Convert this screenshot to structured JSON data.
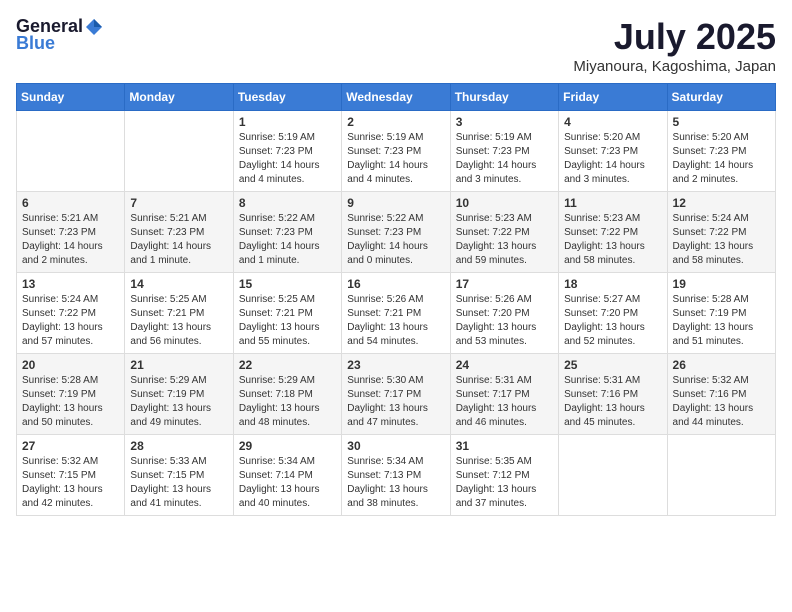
{
  "logo": {
    "general": "General",
    "blue": "Blue"
  },
  "title": "July 2025",
  "subtitle": "Miyanoura, Kagoshima, Japan",
  "headers": [
    "Sunday",
    "Monday",
    "Tuesday",
    "Wednesday",
    "Thursday",
    "Friday",
    "Saturday"
  ],
  "weeks": [
    [
      {
        "day": "",
        "info": ""
      },
      {
        "day": "",
        "info": ""
      },
      {
        "day": "1",
        "info": "Sunrise: 5:19 AM\nSunset: 7:23 PM\nDaylight: 14 hours and 4 minutes."
      },
      {
        "day": "2",
        "info": "Sunrise: 5:19 AM\nSunset: 7:23 PM\nDaylight: 14 hours and 4 minutes."
      },
      {
        "day": "3",
        "info": "Sunrise: 5:19 AM\nSunset: 7:23 PM\nDaylight: 14 hours and 3 minutes."
      },
      {
        "day": "4",
        "info": "Sunrise: 5:20 AM\nSunset: 7:23 PM\nDaylight: 14 hours and 3 minutes."
      },
      {
        "day": "5",
        "info": "Sunrise: 5:20 AM\nSunset: 7:23 PM\nDaylight: 14 hours and 2 minutes."
      }
    ],
    [
      {
        "day": "6",
        "info": "Sunrise: 5:21 AM\nSunset: 7:23 PM\nDaylight: 14 hours and 2 minutes."
      },
      {
        "day": "7",
        "info": "Sunrise: 5:21 AM\nSunset: 7:23 PM\nDaylight: 14 hours and 1 minute."
      },
      {
        "day": "8",
        "info": "Sunrise: 5:22 AM\nSunset: 7:23 PM\nDaylight: 14 hours and 1 minute."
      },
      {
        "day": "9",
        "info": "Sunrise: 5:22 AM\nSunset: 7:23 PM\nDaylight: 14 hours and 0 minutes."
      },
      {
        "day": "10",
        "info": "Sunrise: 5:23 AM\nSunset: 7:22 PM\nDaylight: 13 hours and 59 minutes."
      },
      {
        "day": "11",
        "info": "Sunrise: 5:23 AM\nSunset: 7:22 PM\nDaylight: 13 hours and 58 minutes."
      },
      {
        "day": "12",
        "info": "Sunrise: 5:24 AM\nSunset: 7:22 PM\nDaylight: 13 hours and 58 minutes."
      }
    ],
    [
      {
        "day": "13",
        "info": "Sunrise: 5:24 AM\nSunset: 7:22 PM\nDaylight: 13 hours and 57 minutes."
      },
      {
        "day": "14",
        "info": "Sunrise: 5:25 AM\nSunset: 7:21 PM\nDaylight: 13 hours and 56 minutes."
      },
      {
        "day": "15",
        "info": "Sunrise: 5:25 AM\nSunset: 7:21 PM\nDaylight: 13 hours and 55 minutes."
      },
      {
        "day": "16",
        "info": "Sunrise: 5:26 AM\nSunset: 7:21 PM\nDaylight: 13 hours and 54 minutes."
      },
      {
        "day": "17",
        "info": "Sunrise: 5:26 AM\nSunset: 7:20 PM\nDaylight: 13 hours and 53 minutes."
      },
      {
        "day": "18",
        "info": "Sunrise: 5:27 AM\nSunset: 7:20 PM\nDaylight: 13 hours and 52 minutes."
      },
      {
        "day": "19",
        "info": "Sunrise: 5:28 AM\nSunset: 7:19 PM\nDaylight: 13 hours and 51 minutes."
      }
    ],
    [
      {
        "day": "20",
        "info": "Sunrise: 5:28 AM\nSunset: 7:19 PM\nDaylight: 13 hours and 50 minutes."
      },
      {
        "day": "21",
        "info": "Sunrise: 5:29 AM\nSunset: 7:19 PM\nDaylight: 13 hours and 49 minutes."
      },
      {
        "day": "22",
        "info": "Sunrise: 5:29 AM\nSunset: 7:18 PM\nDaylight: 13 hours and 48 minutes."
      },
      {
        "day": "23",
        "info": "Sunrise: 5:30 AM\nSunset: 7:17 PM\nDaylight: 13 hours and 47 minutes."
      },
      {
        "day": "24",
        "info": "Sunrise: 5:31 AM\nSunset: 7:17 PM\nDaylight: 13 hours and 46 minutes."
      },
      {
        "day": "25",
        "info": "Sunrise: 5:31 AM\nSunset: 7:16 PM\nDaylight: 13 hours and 45 minutes."
      },
      {
        "day": "26",
        "info": "Sunrise: 5:32 AM\nSunset: 7:16 PM\nDaylight: 13 hours and 44 minutes."
      }
    ],
    [
      {
        "day": "27",
        "info": "Sunrise: 5:32 AM\nSunset: 7:15 PM\nDaylight: 13 hours and 42 minutes."
      },
      {
        "day": "28",
        "info": "Sunrise: 5:33 AM\nSunset: 7:15 PM\nDaylight: 13 hours and 41 minutes."
      },
      {
        "day": "29",
        "info": "Sunrise: 5:34 AM\nSunset: 7:14 PM\nDaylight: 13 hours and 40 minutes."
      },
      {
        "day": "30",
        "info": "Sunrise: 5:34 AM\nSunset: 7:13 PM\nDaylight: 13 hours and 38 minutes."
      },
      {
        "day": "31",
        "info": "Sunrise: 5:35 AM\nSunset: 7:12 PM\nDaylight: 13 hours and 37 minutes."
      },
      {
        "day": "",
        "info": ""
      },
      {
        "day": "",
        "info": ""
      }
    ]
  ]
}
